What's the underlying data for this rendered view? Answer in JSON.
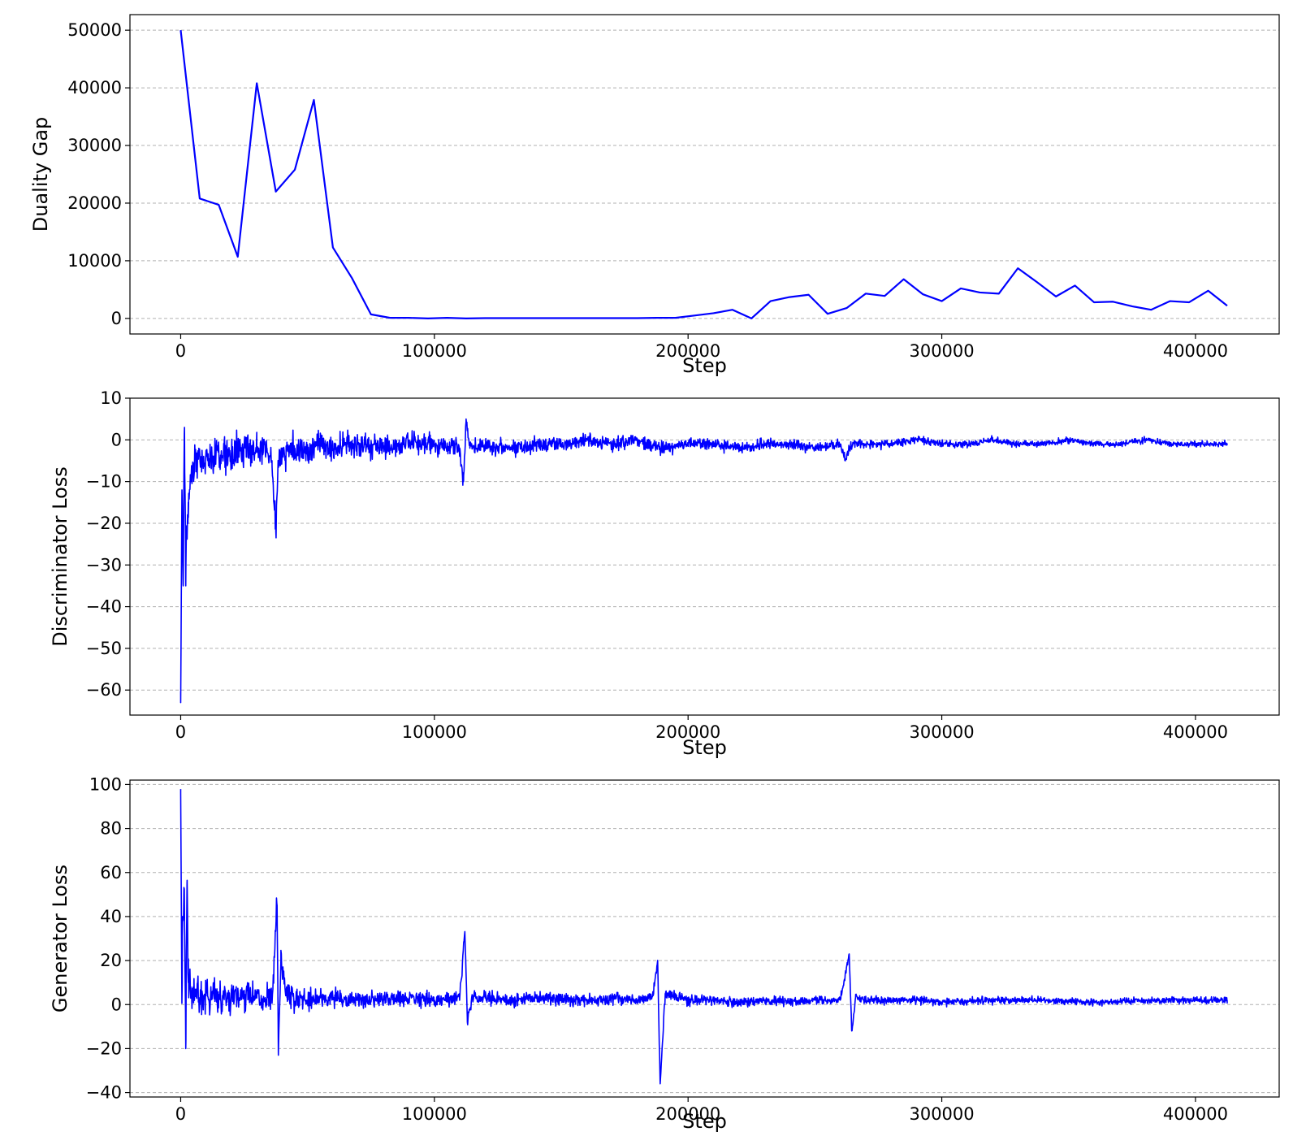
{
  "chart_data": [
    {
      "type": "line",
      "title": "",
      "xlabel": "Step",
      "ylabel": "Duality Gap",
      "xlim": [
        -20000,
        433000
      ],
      "ylim": [
        -2700,
        52700
      ],
      "xticks": [
        0,
        100000,
        200000,
        300000,
        400000
      ],
      "yticks": [
        0,
        10000,
        20000,
        30000,
        40000,
        50000
      ],
      "grid": true,
      "color": "#0000ff",
      "x": [
        0,
        7500,
        15000,
        22500,
        30000,
        37500,
        45000,
        52500,
        60000,
        67500,
        75000,
        82500,
        90000,
        97500,
        105000,
        112500,
        120000,
        127500,
        135000,
        142500,
        150000,
        157500,
        165000,
        172500,
        180000,
        187500,
        195000,
        202500,
        210000,
        217500,
        225000,
        232500,
        240000,
        247500,
        255000,
        262500,
        270000,
        277500,
        285000,
        292500,
        300000,
        307500,
        315000,
        322500,
        330000,
        337500,
        345000,
        352500,
        360000,
        367500,
        375000,
        382500,
        390000,
        397500,
        405000,
        412500
      ],
      "y": [
        50000,
        20800,
        19700,
        10700,
        40800,
        22000,
        25800,
        37900,
        12300,
        7000,
        700,
        100,
        100,
        0,
        100,
        0,
        50,
        50,
        50,
        50,
        50,
        50,
        50,
        50,
        50,
        100,
        100,
        500,
        900,
        1500,
        0,
        3000,
        3700,
        4100,
        800,
        1800,
        4300,
        3900,
        6800,
        4200,
        3000,
        5200,
        4500,
        4300,
        8700,
        6300,
        3800,
        5700,
        2800,
        2900,
        2100,
        1500,
        3000,
        2800,
        4800,
        2200
      ]
    },
    {
      "type": "line",
      "title": "",
      "xlabel": "Step",
      "ylabel": "Discriminator Loss",
      "xlim": [
        -20000,
        433000
      ],
      "ylim": [
        -66,
        10
      ],
      "xticks": [
        0,
        100000,
        200000,
        300000,
        400000
      ],
      "yticks": [
        10,
        0,
        -10,
        -20,
        -30,
        -40,
        -50,
        -60
      ],
      "grid": true,
      "color": "#0000ff",
      "x": [
        0,
        500,
        1000,
        1500,
        2000,
        2500,
        3000,
        4000,
        5000,
        6000,
        8000,
        10000,
        13000,
        16000,
        20000,
        25000,
        30000,
        34000,
        36000,
        37500,
        38500,
        40000,
        45000,
        50000,
        55000,
        60000,
        70000,
        80000,
        90000,
        100000,
        110000,
        111500,
        112500,
        114000,
        120000,
        130000,
        140000,
        150000,
        160000,
        170000,
        180000,
        190000,
        200000,
        210000,
        220000,
        230000,
        240000,
        250000,
        260000,
        262000,
        263500,
        265000,
        270000,
        280000,
        290000,
        300000,
        310000,
        320000,
        330000,
        340000,
        350000,
        360000,
        370000,
        380000,
        390000,
        400000,
        410000,
        412500
      ],
      "y": [
        -63,
        -12,
        -35,
        3,
        -35,
        -22,
        -15,
        -10,
        -8,
        -5,
        -6,
        -4,
        -5,
        -3,
        -4,
        -2,
        -3,
        -2,
        -5,
        -22,
        -5,
        -3,
        -2,
        -3,
        -1,
        -2,
        -1,
        -2,
        -1,
        -1,
        -2,
        -10,
        5,
        -2,
        -1,
        -2,
        -1,
        -1,
        0,
        -1,
        0,
        -2,
        -1,
        -1,
        -2,
        -1,
        -1,
        -2,
        -1,
        -5,
        -2,
        -1,
        -1,
        -1,
        0,
        -1,
        -1,
        0,
        -1,
        -1,
        0,
        -1,
        -1,
        0,
        -1,
        -1,
        -1,
        -1
      ],
      "noise_envelope": {
        "x": [
          0,
          5000,
          15000,
          30000,
          45000,
          60000,
          80000,
          100000,
          120000,
          150000,
          180000,
          200000,
          230000,
          260000,
          300000,
          350000,
          400000,
          412500
        ],
        "amplitude": [
          10,
          7,
          6.5,
          6,
          5.5,
          5,
          4.5,
          3.5,
          3,
          2.6,
          2.4,
          2.2,
          1.8,
          1.6,
          1.3,
          1.1,
          1.0,
          1.0
        ]
      }
    },
    {
      "type": "line",
      "title": "",
      "xlabel": "Step",
      "ylabel": "Generator Loss",
      "xlim": [
        -20000,
        433000
      ],
      "ylim": [
        -42,
        102
      ],
      "xticks": [
        0,
        100000,
        200000,
        300000,
        400000
      ],
      "yticks": [
        100,
        80,
        60,
        40,
        20,
        0,
        -20,
        -40
      ],
      "grid": true,
      "color": "#0000ff",
      "x": [
        0,
        300,
        600,
        1000,
        1500,
        2000,
        2500,
        3000,
        4000,
        5000,
        6000,
        8000,
        10000,
        15000,
        20000,
        30000,
        36000,
        38000,
        38500,
        39500,
        42000,
        50000,
        60000,
        70000,
        80000,
        90000,
        100000,
        110000,
        112000,
        113000,
        115000,
        120000,
        130000,
        140000,
        150000,
        160000,
        170000,
        180000,
        186000,
        188000,
        189000,
        191000,
        200000,
        210000,
        220000,
        230000,
        240000,
        250000,
        260000,
        263500,
        264500,
        266000,
        270000,
        280000,
        290000,
        300000,
        320000,
        340000,
        360000,
        380000,
        400000,
        412500
      ],
      "y": [
        96,
        35,
        10,
        40,
        42,
        -20,
        55,
        10,
        8,
        5,
        7,
        4,
        5,
        3,
        4,
        3,
        2,
        45,
        -23,
        20,
        3,
        2,
        3,
        2,
        2,
        3,
        2,
        3,
        33,
        -8,
        4,
        3,
        2,
        3,
        2,
        2,
        3,
        2,
        4,
        20,
        -36,
        5,
        2,
        2,
        1,
        2,
        1,
        2,
        2,
        23,
        -12,
        3,
        2,
        2,
        2,
        1,
        2,
        2,
        1,
        2,
        2,
        2
      ],
      "noise_envelope": {
        "x": [
          0,
          5000,
          15000,
          30000,
          45000,
          60000,
          80000,
          100000,
          120000,
          150000,
          180000,
          200000,
          230000,
          260000,
          300000,
          350000,
          400000,
          412500
        ],
        "amplitude": [
          25,
          14,
          11,
          10,
          8,
          6,
          5.5,
          5,
          4.5,
          4.2,
          4,
          3.5,
          3,
          2.8,
          2.5,
          2.3,
          2.2,
          2.2
        ]
      }
    }
  ]
}
